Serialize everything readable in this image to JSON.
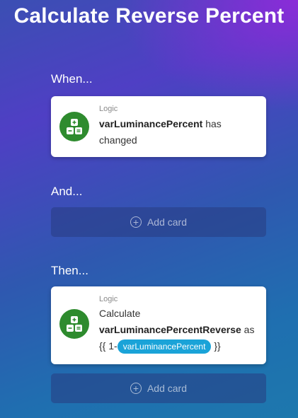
{
  "title": "Calculate Reverse Percent",
  "sections": {
    "when": "When...",
    "and": "And...",
    "then": "Then..."
  },
  "when_card": {
    "type": "Logic",
    "variable": "varLuminancePercent",
    "text_after": "has",
    "text_line2": "changed",
    "icon": "logic-icon"
  },
  "then_card": {
    "type": "Logic",
    "line1": "Calculate",
    "variable": "varLuminancePercentReverse",
    "as": "as",
    "expr_prefix": "{{ 1-",
    "chip": "varLuminancePercent",
    "expr_suffix": "}}",
    "icon": "logic-icon"
  },
  "add_card_label": "Add card",
  "colors": {
    "logic_icon_bg": "#2e8b2e",
    "chip_bg": "#1aa3d8"
  }
}
